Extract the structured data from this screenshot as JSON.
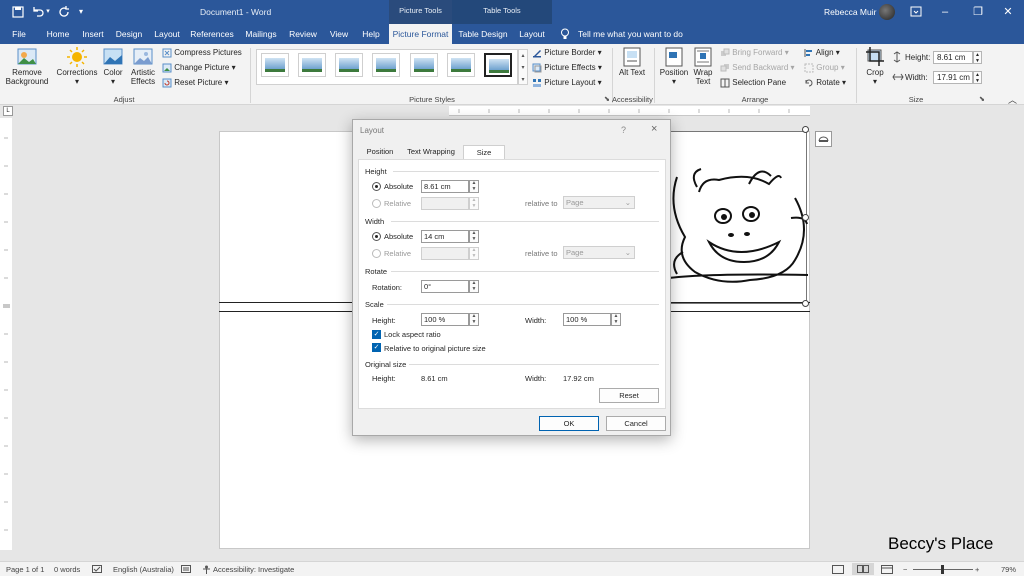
{
  "titlebar": {
    "document_title": "Document1 - Word",
    "context_picture_tools": "Picture Tools",
    "context_table_tools": "Table Tools",
    "user_name": "Rebecca Muir"
  },
  "tabs": [
    "File",
    "Home",
    "Insert",
    "Design",
    "Layout",
    "References",
    "Mailings",
    "Review",
    "View",
    "Help",
    "Picture Format",
    "Table Design",
    "Layout"
  ],
  "active_tab": "Picture Format",
  "tell_me": "Tell me what you want to do",
  "ribbon": {
    "remove_background": "Remove Background",
    "corrections": "Corrections",
    "color": "Color",
    "artistic_effects": "Artistic Effects",
    "compress_pictures": "Compress Pictures",
    "change_picture": "Change Picture",
    "reset_picture": "Reset Picture",
    "group_adjust": "Adjust",
    "group_picture_styles": "Picture Styles",
    "picture_border": "Picture Border",
    "picture_effects": "Picture Effects",
    "picture_layout": "Picture Layout",
    "alt_text": "Alt Text",
    "group_accessibility": "Accessibility",
    "position": "Position",
    "wrap_text": "Wrap Text",
    "bring_forward": "Bring Forward",
    "send_backward": "Send Backward",
    "selection_pane": "Selection Pane",
    "align": "Align",
    "group": "Group",
    "rotate": "Rotate",
    "group_arrange": "Arrange",
    "crop": "Crop",
    "height_label": "Height:",
    "height_value": "8.61 cm",
    "width_label": "Width:",
    "width_value": "17.91 cm",
    "group_size": "Size"
  },
  "dialog": {
    "title": "Layout",
    "help": "?",
    "close": "×",
    "tabs": [
      "Position",
      "Text Wrapping",
      "Size"
    ],
    "active_tab": "Size",
    "height_section": "Height",
    "width_section": "Width",
    "absolute": "Absolute",
    "relative": "Relative",
    "relative_to": "relative to",
    "height_absolute_value": "8.61 cm",
    "width_absolute_value": "14 cm",
    "relative_to_page": "Page",
    "rotate_section": "Rotate",
    "rotation_label": "Rotation:",
    "rotation_value": "0°",
    "scale_section": "Scale",
    "scale_height_label": "Height:",
    "scale_height_value": "100 %",
    "scale_width_label": "Width:",
    "scale_width_value": "100 %",
    "lock_aspect_ratio": "Lock aspect ratio",
    "lock_aspect_ratio_checked": true,
    "relative_to_original": "Relative to original picture size",
    "relative_to_original_checked": true,
    "original_size_section": "Original size",
    "original_height_label": "Height:",
    "original_height_value": "8.61 cm",
    "original_width_label": "Width:",
    "original_width_value": "17.92 cm",
    "reset": "Reset",
    "ok": "OK",
    "cancel": "Cancel"
  },
  "statusbar": {
    "page": "Page 1 of 1",
    "words": "0 words",
    "language": "English (Australia)",
    "accessibility": "Accessibility: Investigate",
    "zoom": "79%"
  },
  "watermark": "Beccy's Place",
  "colors": {
    "accent": "#2b579a",
    "context_picture": "#2a4b7c",
    "context_table": "#23487a",
    "primary_button_border": "#0063b1"
  }
}
